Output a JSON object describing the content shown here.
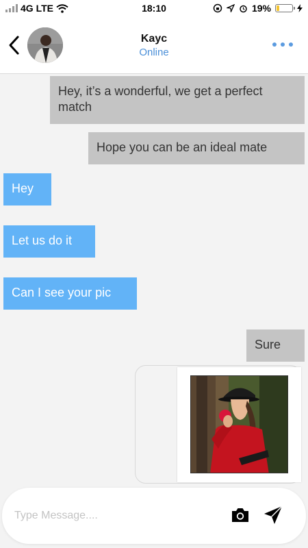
{
  "status_bar": {
    "carrier": "4G LTE",
    "time": "18:10",
    "battery": "19%",
    "battery_level": 0.19,
    "battery_color": "#f4c430"
  },
  "header": {
    "contact_name": "Kayc",
    "contact_status": "Online",
    "back_icon": "chevron-left-icon",
    "more_icon": "more-horizontal-icon",
    "accent_color": "#4a8fd8"
  },
  "messages": [
    {
      "direction": "outgoing",
      "text": "Hey, it’s a wonderful, we get a perfect match"
    },
    {
      "direction": "outgoing",
      "text": "Hope you can be an ideal mate"
    },
    {
      "direction": "incoming",
      "text": "Hey"
    },
    {
      "direction": "incoming",
      "text": "Let us do it"
    },
    {
      "direction": "incoming",
      "text": "Can I see your pic"
    },
    {
      "direction": "outgoing",
      "text": "Sure"
    },
    {
      "direction": "outgoing",
      "type": "image",
      "content": "photo-of-woman-in-red-sweater"
    }
  ],
  "composer": {
    "placeholder": "Type Message....",
    "value": "",
    "camera_icon": "camera-icon",
    "send_icon": "send-icon"
  },
  "colors": {
    "incoming_bubble": "#62b3f7",
    "outgoing_bubble": "#c4c4c4",
    "background": "#f3f3f3"
  }
}
